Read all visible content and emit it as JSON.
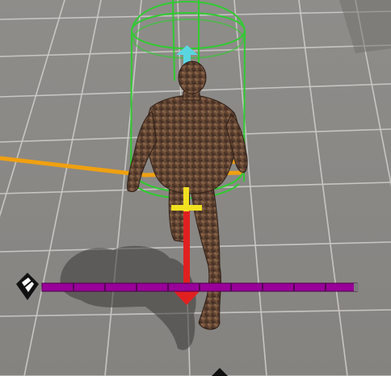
{
  "viewport": {
    "scene": "3d-level-viewport",
    "colors": {
      "floor": "#8d8b88",
      "floor_dark": "#6f6d6a",
      "grid_line": "#d3d1ce",
      "capsule": "#2ecc2e",
      "arrow_x": "#e02020",
      "arrow_y": "#f0e020",
      "arrow_forward": "#5ad6e0",
      "track_line": "#f0a010",
      "timeline": "#990099",
      "character_skin": "#6b4a33"
    }
  },
  "timeline": {
    "segments": 10,
    "icon": "camera-rig-icon"
  },
  "character": {
    "name": "mannequin-character",
    "icon": "character-mesh"
  }
}
